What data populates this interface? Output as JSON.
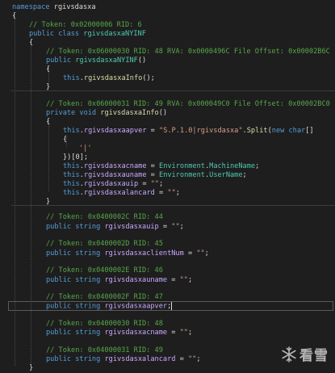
{
  "code": {
    "namespace_kw": "namespace",
    "namespace_name": "rgivsdasxa",
    "brace_open": "{",
    "brace_close": "}",
    "class_comment": "// Token: 0x02000006 RID: 6",
    "public": "public",
    "class_kw": "class",
    "class_name": "rgivsdasxaNYINF",
    "ctor_comment": "// Token: 0x06000030 RID: 48 RVA: 0x0000496C File Offset: 0x00002B6C",
    "ctor_name": "rgivsdasxaNYINF",
    "parens": "()",
    "this_kw": "this",
    "call_info": "rgivsdasxaInfo",
    "call_tail": "();",
    "info_comment": "// Token: 0x06000031 RID: 49 RVA: 0x000049C0 File Offset: 0x00002BC0",
    "private": "private",
    "void": "void",
    "method_name": "rgivsdasxaInfo",
    "f_apver": "rgivsdasxaapver",
    "assign": " = ",
    "apver_str": "\"S.P.1.0|rgivsdasxa\"",
    "split": "Split",
    "new_kw": "new",
    "char_kw": "char",
    "pipe_char": "'|'",
    "index_tail": "})[0];",
    "f_cname": "rgivsdasxacname",
    "environment": "Environment",
    "machine_name": "MachineName",
    "f_uname": "rgivsdasxauname",
    "user_name": "UserName",
    "f_uip": "rgivsdasxauip",
    "empty_str": "\"\"",
    "f_lancard": "rgivsdasxalancard",
    "string_kw": "string",
    "f_clientnum": "rgivsdasxaclientNum",
    "field_comments": [
      "// Token: 0x0400002C RID: 44",
      "// Token: 0x0400002D RID: 45",
      "// Token: 0x0400002E RID: 46",
      "// Token: 0x0400002F RID: 47",
      "// Token: 0x04000030 RID: 48",
      "// Token: 0x04000031 RID: 49"
    ]
  },
  "watermark": {
    "text": "看雪",
    "icon": "snowflake-icon"
  },
  "colors": {
    "background": "#1e1e1e",
    "keyword": "#569cd6",
    "type": "#4ec9b0",
    "method": "#dcdcaa",
    "string": "#d69d85",
    "comment": "#57a64a",
    "plain": "#dcdcdc"
  }
}
